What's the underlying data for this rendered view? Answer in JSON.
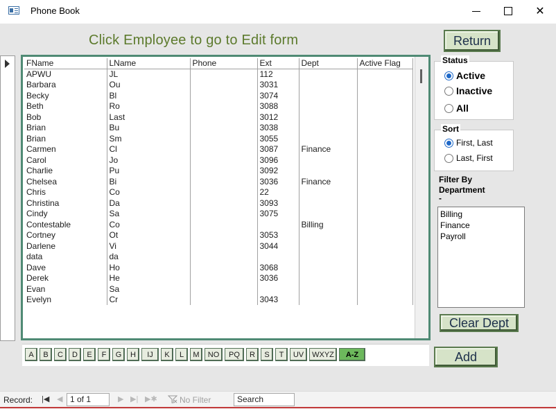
{
  "window": {
    "title": "Phone Book"
  },
  "form": {
    "heading": "Click Employee to go to Edit form",
    "return_label": "Return",
    "clear_dept_label": "Clear Dept",
    "add_label": "Add"
  },
  "table": {
    "columns": [
      "FName",
      "LName",
      "Phone",
      "Ext",
      "Dept",
      "Active Flag"
    ],
    "rows": [
      [
        "APWU",
        "JL",
        "",
        "112",
        "",
        ""
      ],
      [
        "Barbara",
        "Ou",
        "",
        "3031",
        "",
        ""
      ],
      [
        "Becky",
        "Bl",
        "",
        "3074",
        "",
        ""
      ],
      [
        "Beth",
        "Ro",
        "",
        "3088",
        "",
        ""
      ],
      [
        "Bob",
        "Last",
        "",
        "3012",
        "",
        ""
      ],
      [
        "Brian",
        "Bu",
        "",
        "3038",
        "",
        ""
      ],
      [
        "Brian",
        "Sm",
        "",
        "3055",
        "",
        ""
      ],
      [
        "Carmen",
        "Cl",
        "",
        "3087",
        "Finance",
        ""
      ],
      [
        "Carol",
        "Jo",
        "",
        "3096",
        "",
        ""
      ],
      [
        "Charlie",
        "Pu",
        "",
        "3092",
        "",
        ""
      ],
      [
        "Chelsea",
        "Bi",
        "",
        "3036",
        "Finance",
        ""
      ],
      [
        "Chris",
        "Co",
        "",
        "22",
        "",
        ""
      ],
      [
        "Christina",
        "Da",
        "",
        "3093",
        "",
        ""
      ],
      [
        "Cindy",
        "Sa",
        "",
        "3075",
        "",
        ""
      ],
      [
        "Contestable",
        "Co",
        "",
        "",
        "Billing",
        ""
      ],
      [
        "Cortney",
        "Ot",
        "",
        "3053",
        "",
        ""
      ],
      [
        "Darlene",
        "Vi",
        "",
        "3044",
        "",
        ""
      ],
      [
        "data",
        "da",
        "",
        "",
        "",
        ""
      ],
      [
        "Dave",
        "Ho",
        "",
        "3068",
        "",
        ""
      ],
      [
        "Derek",
        "He",
        "",
        "3036",
        "",
        ""
      ],
      [
        "Evan",
        "Sa",
        "",
        "",
        "",
        ""
      ],
      [
        "Evelyn",
        "Cr",
        "",
        "3043",
        "",
        ""
      ]
    ]
  },
  "status_group": {
    "label": "Status",
    "options": [
      "Active",
      "Inactive",
      "All"
    ],
    "selected": "Active"
  },
  "sort_group": {
    "label": "Sort",
    "options": [
      "First, Last",
      "Last, First"
    ],
    "selected": "First, Last"
  },
  "filter": {
    "label_line1": "Filter By",
    "label_line2": "Department",
    "label_line3": "-",
    "departments": [
      "Billing",
      "Finance",
      "Payroll"
    ]
  },
  "alphabet": {
    "buttons": [
      "A",
      "B",
      "C",
      "D",
      "E",
      "F",
      "G",
      "H",
      "IJ",
      "K",
      "L",
      "M",
      "NO",
      "PQ",
      "R",
      "S",
      "T",
      "UV",
      "WXYZ",
      "A-Z"
    ],
    "selected": "A-Z"
  },
  "navigation": {
    "record_label": "Record:",
    "record_value": "1 of 1",
    "no_filter_label": "No Filter",
    "search_label": "Search"
  },
  "colors": {
    "heading": "#5c7a2c",
    "list_border": "#4f8a74",
    "button_fill": "#d6e3c8",
    "active_letter": "#6cb85c",
    "radio_selected": "#1e68c8"
  },
  "icons": [
    "app-icon",
    "minimize-icon",
    "maximize-icon",
    "close-icon",
    "record-selector-arrow-icon",
    "first-record-icon",
    "previous-record-icon",
    "next-record-icon",
    "last-record-icon",
    "new-record-icon",
    "filter-icon"
  ]
}
